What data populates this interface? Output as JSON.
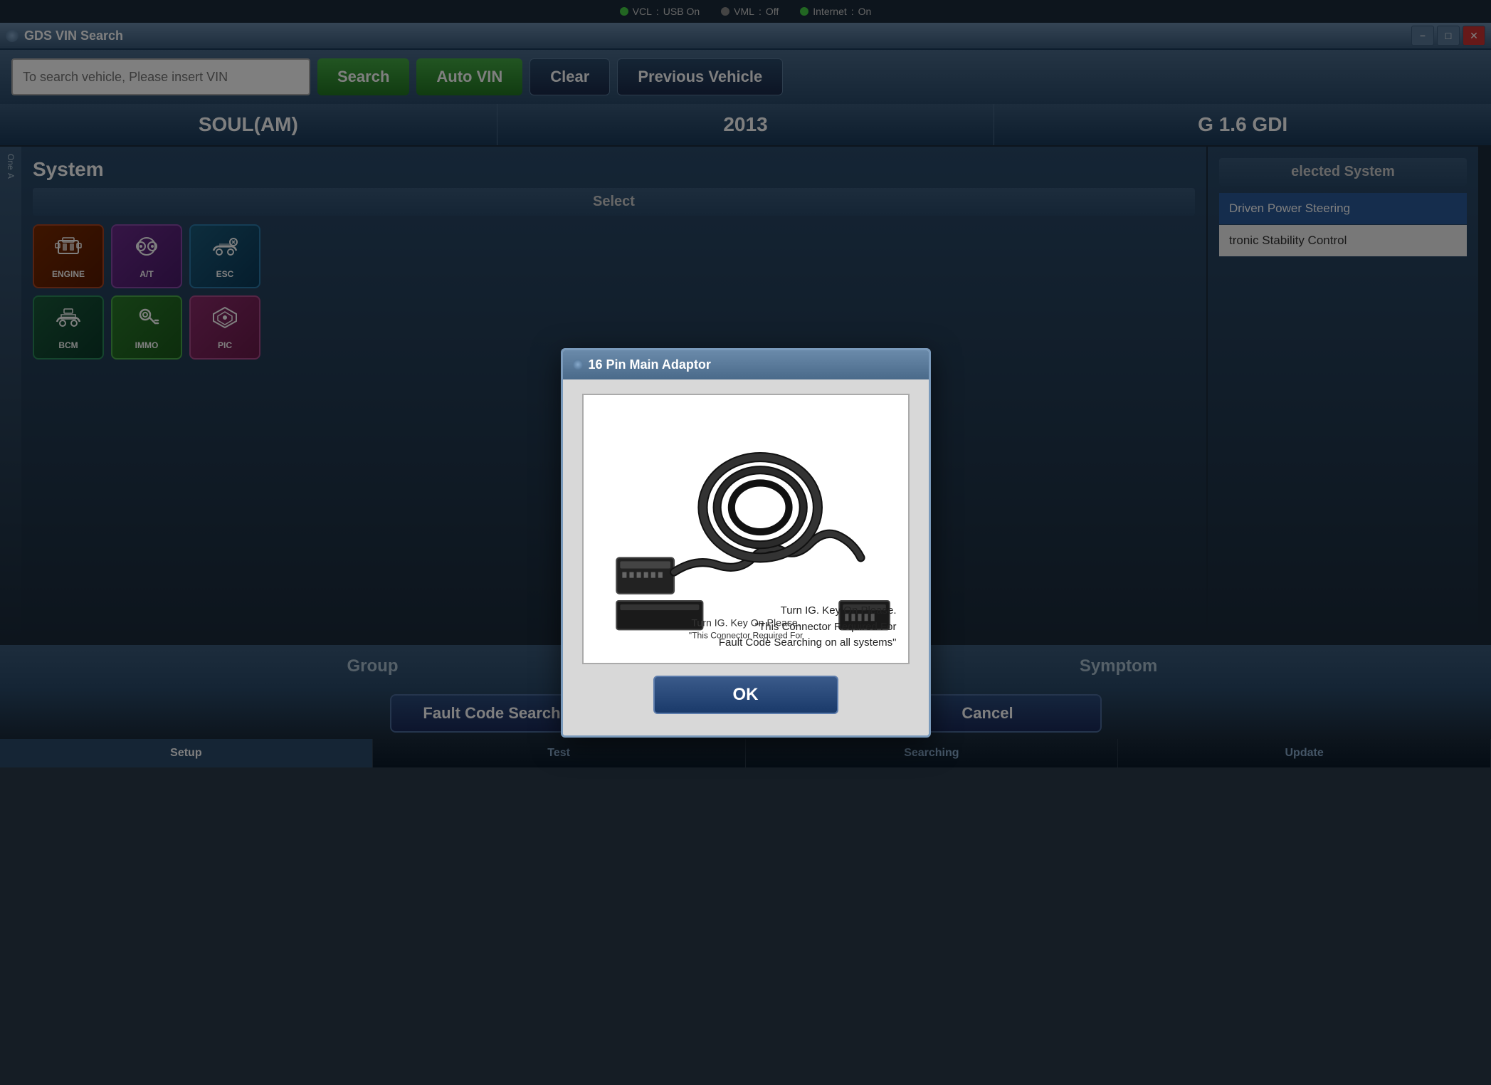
{
  "statusBar": {
    "vcl": "VCL",
    "vclStatus": "USB On",
    "vml": "VML",
    "vmlStatus": "Off",
    "internet": "Internet",
    "internetStatus": "On"
  },
  "titleBar": {
    "title": "GDS VIN Search",
    "minimize": "−",
    "maximize": "□",
    "close": "✕"
  },
  "searchBar": {
    "vinPlaceholder": "To search vehicle, Please insert VIN",
    "searchLabel": "Search",
    "autoVinLabel": "Auto VIN",
    "clearLabel": "Clear",
    "previousVehicleLabel": "Previous Vehicle"
  },
  "vehicleBar": {
    "model": "SOUL(AM)",
    "year": "2013",
    "engine": "G 1.6 GDI"
  },
  "systemSection": {
    "title": "System",
    "selectLabel": "Select",
    "icons": [
      {
        "id": "engine",
        "label": "ENGINE",
        "symbol": "⚙"
      },
      {
        "id": "at",
        "label": "A/T",
        "symbol": "⚙"
      },
      {
        "id": "esc",
        "label": "ESC",
        "symbol": "🚗"
      },
      {
        "id": "bcm",
        "label": "BCM",
        "symbol": "🚗"
      },
      {
        "id": "immo",
        "label": "IMMO",
        "symbol": "🔑"
      },
      {
        "id": "pic",
        "label": "PIC",
        "symbol": "⬡"
      }
    ]
  },
  "selectedSection": {
    "title": "elected System",
    "items": [
      {
        "text": "Driven Power Steering",
        "active": true
      },
      {
        "text": "tronic Stability Control",
        "active": false
      }
    ]
  },
  "bottomBar": {
    "groupLabel": "Group",
    "symptomLabel": "Symptom"
  },
  "actionBar": {
    "faultCodeLabel": "Fault Code Searching",
    "okLabel": "OK",
    "cancelLabel": "Cancel"
  },
  "tabBar": {
    "tabs": [
      "Setup",
      "Test",
      "Searching",
      "Update"
    ]
  },
  "modal": {
    "title": "16 Pin Main Adaptor",
    "instructionLine1": "Turn IG. Key On Please.",
    "instructionLine2": "\"This Connector Required For",
    "instructionLine3": "Fault Code Searching on all systems\"",
    "okLabel": "OK"
  }
}
